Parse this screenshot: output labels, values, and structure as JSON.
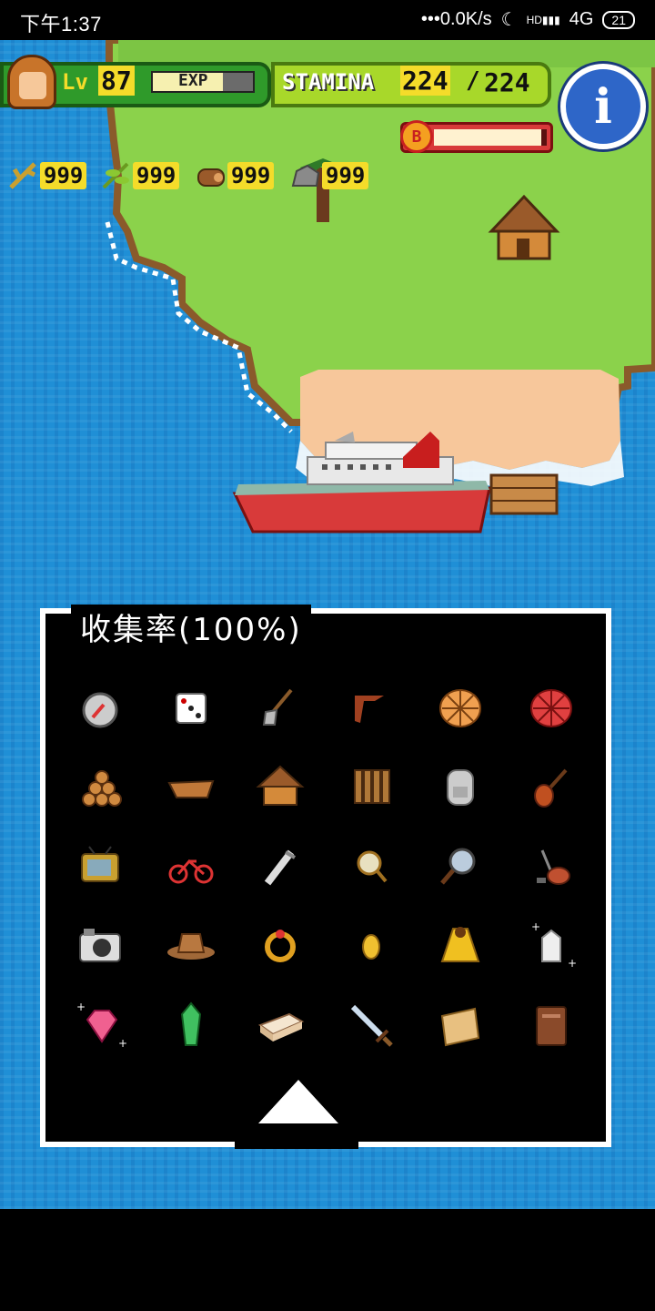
{
  "status_bar": {
    "time": "下午1:37",
    "network_speed": "•••0.0K/s",
    "signal_label": "HD",
    "network_type": "4G",
    "battery": "21"
  },
  "hud": {
    "level_label": "Lv",
    "level": "87",
    "exp_label": "EXP",
    "exp_fill": 0.7,
    "stamina_label": "STAMINA",
    "stamina_current": "224",
    "stamina_separator": "/",
    "stamina_max": "224",
    "boss_badge": "B",
    "boss_fill": 0.95,
    "resources": [
      {
        "icon": "branch-icon",
        "value": "999"
      },
      {
        "icon": "herb-icon",
        "value": "999"
      },
      {
        "icon": "wood-log-icon",
        "value": "999"
      },
      {
        "icon": "stone-icon",
        "value": "999"
      }
    ]
  },
  "collection": {
    "title": "收集率(100%)",
    "items": [
      "compass-icon",
      "dice-icon",
      "shovel-icon",
      "boomerang-icon",
      "orange-net-icon",
      "red-net-icon",
      "log-pile-icon",
      "canoe-icon",
      "hut-icon",
      "raft-icon",
      "backpack-icon",
      "guitar-icon",
      "tv-icon",
      "bicycle-icon",
      "razor-icon",
      "mirror-icon",
      "magnifier-icon",
      "vacuum-icon",
      "camera-icon",
      "cowboy-hat-icon",
      "ring-icon",
      "coin-icon",
      "cape-icon",
      "milk-icon",
      "gem-icon",
      "crystal-icon",
      "bricks-icon",
      "sword-icon",
      "map-scroll-icon",
      "book-icon"
    ]
  },
  "colors": {
    "sea": "#1f8fd6",
    "grass": "#8bd24b",
    "sand": "#f7c79b",
    "hud_green": "#a8d82a",
    "hud_yellow": "#f4dc2a",
    "info_blue": "#2e66c8"
  }
}
